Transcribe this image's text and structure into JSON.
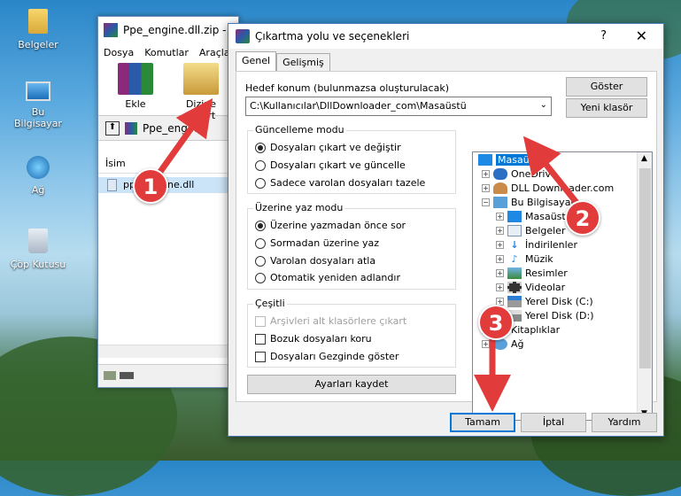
{
  "desktop": {
    "icons": [
      {
        "label": "Belgeler"
      },
      {
        "label": "Bu Bilgisayar"
      },
      {
        "label": "Ağ"
      },
      {
        "label": "Çöp Kutusu"
      }
    ]
  },
  "winrar": {
    "title": "Ppe_engine.dll.zip -",
    "menu": [
      "Dosya",
      "Komutlar",
      "Araçlar"
    ],
    "toolbar": {
      "extract_label": "Ekle",
      "extract_to_label": "Dizine Çıkart"
    },
    "address": "Ppe_engine",
    "column_name": "İsim",
    "file_row": "ppe_engine.dll"
  },
  "dialog": {
    "title": "Çıkartma yolu ve seçenekleri",
    "help": "?",
    "close": "✕",
    "tabs": [
      "Genel",
      "Gelişmiş"
    ],
    "dest_label": "Hedef konum (bulunmazsa oluşturulacak)",
    "dest_value": "C:\\Kullanıcılar\\DllDownloader_com\\Masaüstü",
    "show_button": "Göster",
    "new_folder_button": "Yeni klasör",
    "update_mode": {
      "title": "Güncelleme modu",
      "options": [
        "Dosyaları çıkart ve değiştir",
        "Dosyaları çıkart ve güncelle",
        "Sadece varolan dosyaları tazele"
      ]
    },
    "overwrite_mode": {
      "title": "Üzerine yaz modu",
      "options": [
        "Üzerine yazmadan önce sor",
        "Sormadan üzerine yaz",
        "Varolan dosyaları atla",
        "Otomatik yeniden adlandır"
      ]
    },
    "misc": {
      "title": "Çeşitli",
      "options": [
        "Arşivleri alt klasörlere çıkart",
        "Bozuk dosyaları koru",
        "Dosyaları Gezginde göster"
      ]
    },
    "save_settings": "Ayarları kaydet",
    "tree": {
      "items": [
        "Masaüstü",
        "OneDrive",
        "DLL Downloader.com",
        "Bu Bilgisayar",
        "Masaüstü",
        "Belgeler",
        "İndirilenler",
        "Müzik",
        "Resimler",
        "Videolar",
        "Yerel Disk (C:)",
        "Yerel Disk (D:)",
        "Kitaplıklar",
        "Ağ"
      ]
    },
    "buttons": {
      "ok": "Tamam",
      "cancel": "İptal",
      "help": "Yardım"
    }
  },
  "annotations": {
    "step1": "1",
    "step2": "2",
    "step3": "3"
  }
}
